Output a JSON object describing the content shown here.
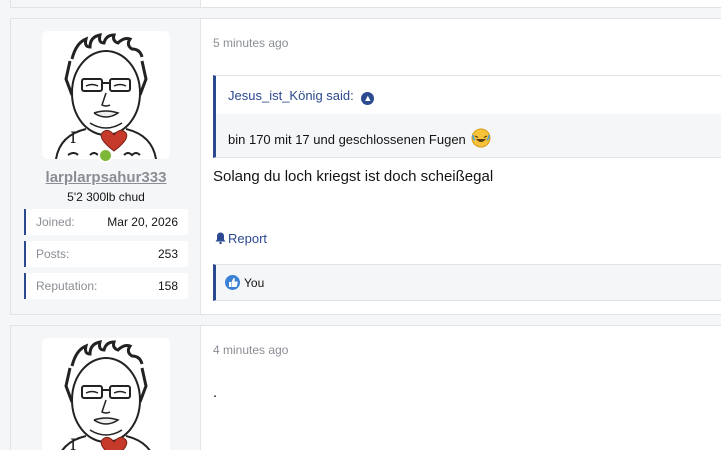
{
  "posts": [
    {
      "user": {
        "name": "larplarpsahur333",
        "title": "5'2 300lb chud"
      },
      "stats": [
        {
          "label": "Joined:",
          "value": "Mar 20, 2026"
        },
        {
          "label": "Posts:",
          "value": "253"
        },
        {
          "label": "Reputation:",
          "value": "158"
        }
      ],
      "time": "5 minutes ago",
      "quote": {
        "author": "Jesus_ist_König said:",
        "text": "bin 170 mit 17 und geschlossenen Fugen"
      },
      "message": "Solang du loch kriegst ist doch scheißegal",
      "report_label": "Report",
      "reactions": {
        "who": "You"
      }
    },
    {
      "time": "4 minutes ago",
      "message": "."
    }
  ],
  "colors": {
    "accent": "#2c4a8f",
    "online": "#7fb838",
    "muted": "#8a8e94"
  },
  "icons": [
    "avatar-drawing",
    "quote-jump-arrow-icon",
    "laughing-emoji-icon",
    "bell-icon",
    "like-reaction-icon"
  ]
}
